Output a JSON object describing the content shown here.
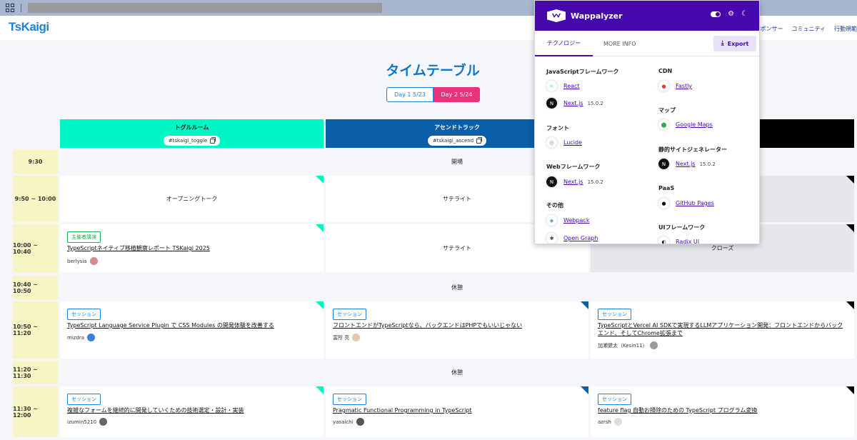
{
  "browser": {},
  "site": {
    "logo": "TsKaigi",
    "nav": [
      "スポンサー",
      "コミュニティ",
      "行動規範"
    ]
  },
  "page": {
    "title": "タイムテーブル",
    "day_tabs": [
      "Day 1 5/23",
      "Day 2 5/24"
    ]
  },
  "tracks": [
    {
      "name": "トグルルーム",
      "tag": "#tskaigi_toggle",
      "color": "#00f5c5"
    },
    {
      "name": "アセンドトラック",
      "tag": "#tskaigi_ascend",
      "color": "#0b5fa8"
    },
    {
      "name": "",
      "tag": "",
      "color": "#000000"
    }
  ],
  "rows": {
    "r1": {
      "time": "9:30",
      "span": "開場"
    },
    "r2": {
      "time": "9:50 ~ 10:00",
      "c1": "オープニングトーク",
      "c2": "サテライト"
    },
    "r3": {
      "time": "10:00 ~ 10:40",
      "c1": {
        "badge": "主催者講演",
        "title": "TypeScriptネイティブ移植観察レポート TSKaigi 2025",
        "speaker": "berlysia"
      },
      "c2": "サテライト",
      "c3": "クローズ"
    },
    "r4": {
      "time": "10:40 ~ 10:50",
      "span": "休憩"
    },
    "r5": {
      "time": "10:50 ~ 11:20",
      "c1": {
        "badge": "セッション",
        "title": "TypeScript Language Service Plugin で CSS Modules の開発体験を改善する",
        "speaker": "mizdra"
      },
      "c2": {
        "badge": "セッション",
        "title": "フロントエンドがTypeScriptなら、バックエンドはPHPでもいいじゃない",
        "speaker": "富所 亮"
      },
      "c3": {
        "badge": "セッション",
        "title": "TypeScriptとVercel AI SDKで実現するLLMアプリケーション開発：フロントエンドからバックエンド、そしてChrome拡張まで",
        "speaker": "加瀬健太（Kesin11）"
      }
    },
    "r6": {
      "time": "11:20 ~ 11:30",
      "span": "休憩"
    },
    "r7": {
      "time": "11:30 ~ 12:00",
      "c1": {
        "badge": "セッション",
        "title": "複雑なフォームを継続的に開発していくための技術選定・設計・実装",
        "speaker": "izumin5210"
      },
      "c2": {
        "badge": "セッション",
        "title": "Pragmatic Functional Programming in TypeScript",
        "speaker": "yasaichi"
      },
      "c3": {
        "badge": "セッション",
        "title": "feature flag 自動お掃除のための TypeScript プログラム変換",
        "speaker": "azrsh"
      }
    }
  },
  "wappalyzer": {
    "title": "Wappalyzer",
    "tabs": {
      "technologies": "テクノロジー",
      "more_info": "MORE INFO"
    },
    "export_label": "Export",
    "left": [
      {
        "category": "JavaScriptフレームワーク",
        "items": [
          {
            "name": "React",
            "version": ""
          },
          {
            "name": "Next.js",
            "version": "15.0.2"
          }
        ]
      },
      {
        "category": "フォント",
        "items": [
          {
            "name": "Lucide",
            "version": ""
          }
        ]
      },
      {
        "category": "Webフレームワーク",
        "items": [
          {
            "name": "Next.js",
            "version": "15.0.2"
          }
        ]
      },
      {
        "category": "その他",
        "items": [
          {
            "name": "Webpack",
            "version": ""
          },
          {
            "name": "Open Graph",
            "version": ""
          }
        ]
      }
    ],
    "right": [
      {
        "category": "CDN",
        "items": [
          {
            "name": "Fastly",
            "version": ""
          }
        ]
      },
      {
        "category": "マップ",
        "items": [
          {
            "name": "Google Maps",
            "version": ""
          }
        ]
      },
      {
        "category": "静的サイトジェネレーター",
        "items": [
          {
            "name": "Next.js",
            "version": "15.0.2"
          }
        ]
      },
      {
        "category": "PaaS",
        "items": [
          {
            "name": "GitHub Pages",
            "version": ""
          }
        ]
      },
      {
        "category": "UIフレームワーク",
        "items": [
          {
            "name": "Radix UI",
            "version": ""
          }
        ]
      }
    ]
  }
}
